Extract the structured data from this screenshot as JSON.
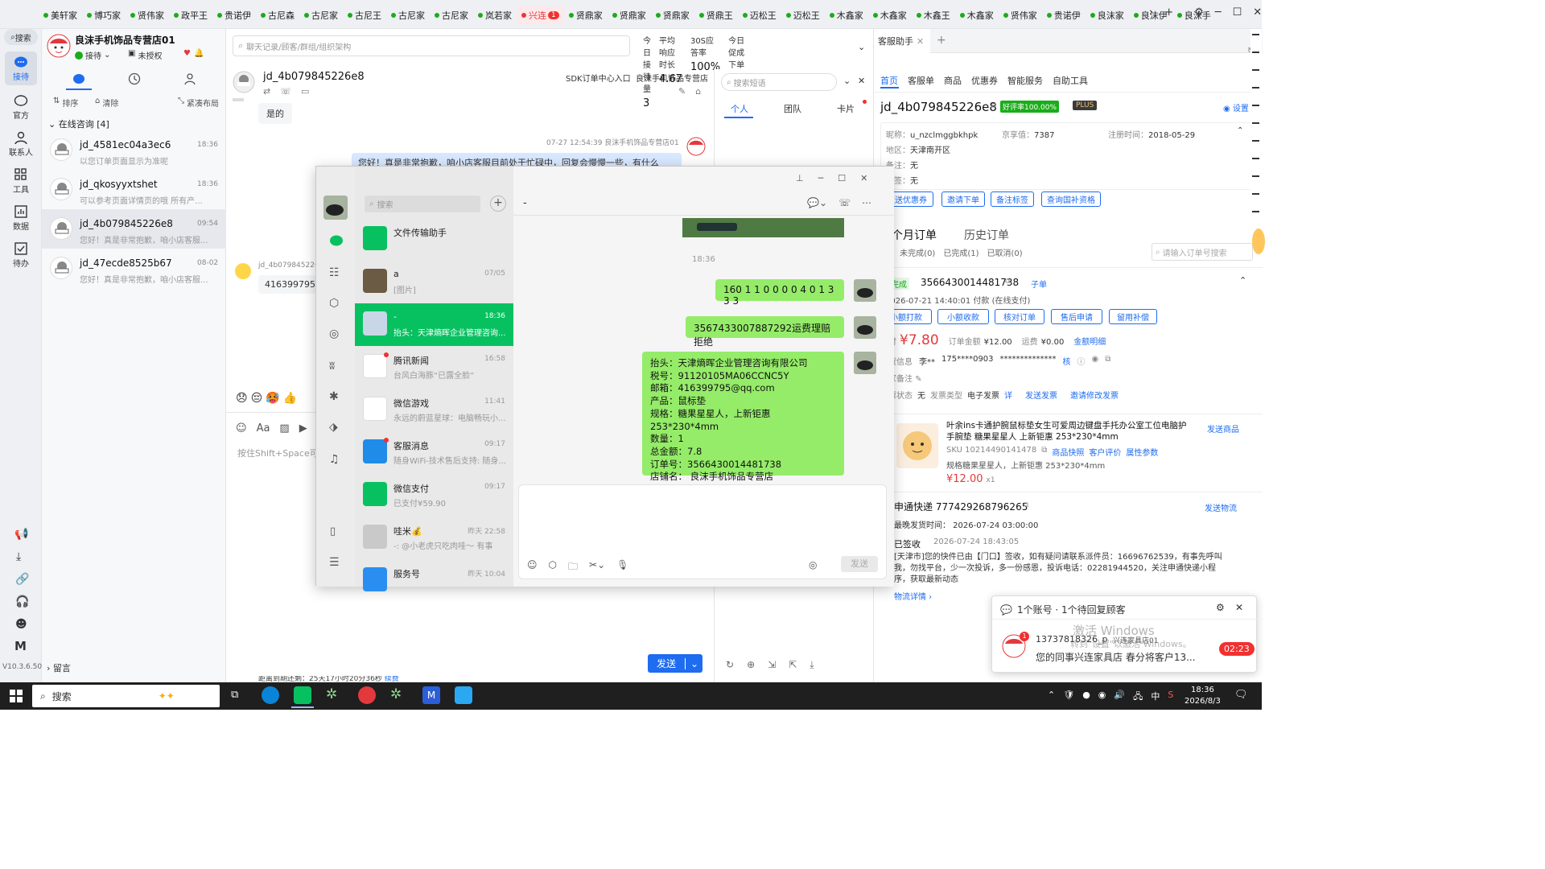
{
  "tabs": [
    "美轩家",
    "博巧家",
    "贤伟家",
    "政平王",
    "贵诺伊",
    "古尼森",
    "古尼家",
    "古尼王",
    "古尼家",
    "古尼家",
    "岚若家",
    "兴连",
    "贤鼎家",
    "贤鼎家",
    "贤鼎家",
    "贤鼎王",
    "迈松王",
    "迈松王",
    "木鑫家",
    "木鑫家",
    "木鑫王",
    "木鑫家",
    "贤伟家",
    "贵诺伊",
    "良沫家",
    "良沫伊",
    "良沫手"
  ],
  "tab_badge": "1",
  "leftnav": {
    "search": "搜索",
    "items": [
      "接待",
      "官方",
      "联系人",
      "工具",
      "数据",
      "待办"
    ],
    "version": "V10.3.6.500"
  },
  "shop": {
    "name": "良沫手机饰品专营店01",
    "status": "接待",
    "auth": "未授权"
  },
  "sessions": {
    "toolbar": [
      "排序",
      "清除",
      "紧凑布局"
    ],
    "group_title": "在线咨询 [4]",
    "items": [
      {
        "name": "jd_4581ec04a3ec6",
        "time": "18:36",
        "preview": "以您订单页面显示为准呢"
      },
      {
        "name": "jd_qkosyyxtshet",
        "time": "18:36",
        "preview": "可以参考页面详情页的哦 所有产..."
      },
      {
        "name": "jd_4b079845226e8",
        "time": "09:54",
        "preview": "您好！真是非常抱歉，咱小店客服..."
      },
      {
        "name": "jd_47ecde8525b67",
        "time": "08-02",
        "preview": "您好！真是非常抱歉，咱小店客服..."
      }
    ],
    "leave_msg": "留言"
  },
  "chat": {
    "search_placeholder": "聊天记录/顾客/群组/组织架构",
    "stats": [
      {
        "label": "今日接待量",
        "value": "3"
      },
      {
        "label": "平均响应时长",
        "value": "4.67"
      },
      {
        "label": "30S应答率",
        "value": "100%"
      },
      {
        "label": "今日促成下单金额",
        "value": "0.00"
      }
    ],
    "customer": "jd_4b079845226e8",
    "sdk_link": "SDK订单中心入口",
    "shop_short": "良沫手机饰品专营店",
    "msg1": "是的",
    "msg2_meta": "07-27 12:54:39  良沫手机饰品专营店01",
    "msg2": "您好！真是非常抱歉，咱小店客服目前处于忙碌中，回复会慢慢一些，有什么",
    "msg3_sender": "jd_4b079845226",
    "msg3": "416399795@",
    "input_hint": "按住Shift+Space可",
    "send": "发送",
    "bottom_note": "距离到期还剩：25天17小时20分36秒",
    "bottom_link": "续费"
  },
  "quick": {
    "search_placeholder": "搜索短语",
    "tabs": [
      "个人",
      "团队",
      "卡片"
    ]
  },
  "right": {
    "tab_title": "客服助手",
    "nav": [
      "首页",
      "客服单",
      "商品",
      "优惠券",
      "智能服务",
      "自助工具"
    ],
    "customer": "jd_4b079845226e8",
    "rating": "好评率100.00%",
    "plus": "PLUS",
    "settings": "设置",
    "nick_label": "昵称：",
    "nick": "u_nzclmggbkhpk",
    "jxz_label": "京享值：",
    "jxz": "7387",
    "reg_label": "注册时间：",
    "reg": "2018-05-29",
    "area_label": "地区：",
    "area": "天津南开区",
    "note_label": "备注：",
    "note": "无",
    "tag_label": "标签：",
    "tag": "无",
    "actions": [
      "发送优惠券",
      "邀请下单",
      "备注标签",
      "查询国补资格"
    ],
    "orders_title": "三个月订单",
    "orders_hist": "历史订单",
    "order_filters": [
      "(1)",
      "未完成(0)",
      "已完成(1)",
      "已取消(0)"
    ],
    "order_search": "请输入订单号搜索",
    "order_status": "已完成",
    "order_no": "3566430014481738",
    "child": "子单",
    "order_time": "2026-07-21 14:40:01",
    "order_pay": "付款 (在线支付)",
    "order_btns": [
      "小额打款",
      "小额收款",
      "核对订单",
      "售后申请",
      "留用补偿"
    ],
    "pay_label": "实付",
    "pay": "¥7.80",
    "amt_label": "订单金额",
    "amt": "¥12.00",
    "fee_label": "运费",
    "fee": "¥0.00",
    "amt_detail": "金额明细",
    "receiver_label": "收货信息",
    "receiver": "李**",
    "phone": "175****0903",
    "masked": "**************",
    "check": "核",
    "buyer_note": "买家备注",
    "invoice_label": "发票状态",
    "invoice": "无",
    "invoice_type_label": "发票类型",
    "invoice_type": "电子发票",
    "invoice_detail": "详",
    "invoice_send": "发送发票",
    "invoice_invite": "邀请修改发票",
    "product_title": "叶余ins卡通护腕鼠标垫女生可爱周边键盘手托办公室工位电脑护手腕垫 糖果星星人 上新钜惠 253*230*4mm",
    "send_product": "发送商品",
    "sku": "SKU 10214490141478",
    "fast": "商品快照",
    "eval": "客户评价",
    "attr": "属性参数",
    "spec": "规格糖果星星人，上新钜惠 253*230*4mm",
    "price": "¥12.00",
    "qty": "x1",
    "express": "申通快递 777429268796265",
    "send_logistics": "发送物流",
    "latest_ship": "最晚发货时间：  2026-07-24 03:00:00",
    "signed": "已签收",
    "signed_time": "2026-07-24 18:43:05",
    "track": "[天津市]您的快件已由【门口】签收，如有疑问请联系派件员：16696762539，有事先呼叫我，勿找平台，少一次投诉，多一份感恩，投诉电话：02281944520，关注申通快递小程序，获取最新动态",
    "logistics_detail": "物流详情"
  },
  "notif": {
    "title": "1个账号 · 1个待回复顾客",
    "phone": "13737818326_p",
    "shop": "兴连家具店01",
    "time": "02:23",
    "msg": "您的同事兴连家具店 春分将客户13...",
    "watermark1": "激活 Windows",
    "watermark2": "转到\"设置\"以激活 Windows。",
    "badge": "1"
  },
  "wechat": {
    "search": "搜索",
    "chat_title": "-",
    "time": "18:36",
    "list": [
      {
        "name": "文件传输助手",
        "time": "",
        "preview": ""
      },
      {
        "name": "a",
        "time": "07/05",
        "preview": "[图片]"
      },
      {
        "name": "-",
        "time": "18:36",
        "preview": "抬头：天津熵晖企业管理咨询..."
      },
      {
        "name": "腾讯新闻",
        "time": "16:58",
        "preview": "台风白海豚“已露全脸”"
      },
      {
        "name": "微信游戏",
        "time": "11:41",
        "preview": "永远的蔚蓝星球：电脑畅玩小..."
      },
      {
        "name": "客服消息",
        "time": "09:17",
        "preview": "随身WiFi-技术售后支持: 随身..."
      },
      {
        "name": "微信支付",
        "time": "09:17",
        "preview": "已支付¥59.90"
      },
      {
        "name": "哇米💰",
        "time": "昨天 22:58",
        "preview": "-: @小老虎只吃肉哇～ 有事"
      },
      {
        "name": "服务号",
        "time": "昨天 10:04",
        "preview": ""
      }
    ],
    "msg1": "160 1 1 0 0 0 0 4 0 1 3 3 3",
    "msg2": "3567433007887292运费理赔拒绝",
    "invoice_lines": [
      "抬头：天津熵晖企业管理咨询有限公司",
      "税号：91120105MA06CCNC5Y",
      "邮箱：416399795@qq.com",
      "产品：鼠标垫",
      "规格：糖果星星人，上新钜惠 253*230*4mm",
      "数量：1",
      "总金额：7.8",
      "订单号：3566430014481738",
      "店铺名： 良沫手机饰品专营店"
    ],
    "send": "发送"
  },
  "taskbar": {
    "search": "搜索",
    "time": "18:36",
    "date": "2026/8/3",
    "ime": "中"
  }
}
